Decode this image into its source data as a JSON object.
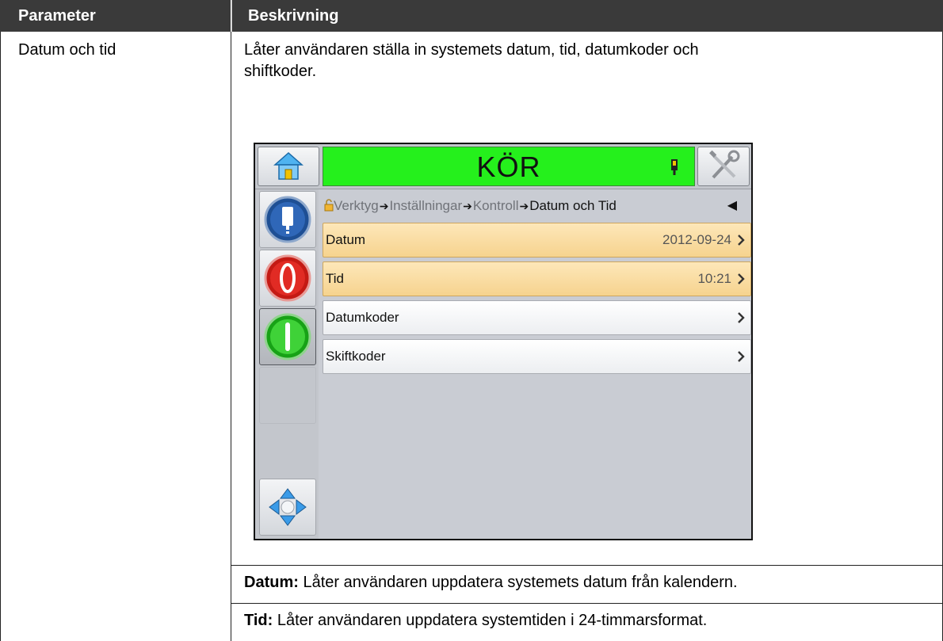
{
  "table": {
    "headers": {
      "param": "Parameter",
      "desc": "Beskrivning"
    },
    "row1": {
      "param": "Datum och tid",
      "desc_line1": "Låter användaren ställa in systemets datum, tid, datumkoder och",
      "desc_line2": "shiftkoder."
    },
    "notes": [
      {
        "term": "Datum:",
        "text": " Låter användaren uppdatera systemets datum från kalendern."
      },
      {
        "term": "Tid:",
        "text": " Låter användaren uppdatera systemtiden i 24-timmarsformat."
      }
    ]
  },
  "device": {
    "status": {
      "text": "KÖR",
      "color": "#25f01c"
    },
    "icons": {
      "home": "home-icon",
      "tools": "tools-icon",
      "ink": "ink-cartridge-icon",
      "info": "info-icon",
      "stop": "stop-icon",
      "start": "start-icon",
      "navigate": "navigation-arrows-icon",
      "lock": "lock-icon",
      "back": "back-arrow-icon"
    },
    "breadcrumb": {
      "items": [
        "Verktyg",
        "Inställningar",
        "Kontroll"
      ],
      "current": "Datum och Tid"
    },
    "menu": [
      {
        "label": "Datum",
        "value": "2012-09-24",
        "selected": true
      },
      {
        "label": "Tid",
        "value": "10:21",
        "selected": true
      },
      {
        "label": "Datumkoder",
        "value": "",
        "selected": false
      },
      {
        "label": "Skiftkoder",
        "value": "",
        "selected": false
      }
    ]
  }
}
